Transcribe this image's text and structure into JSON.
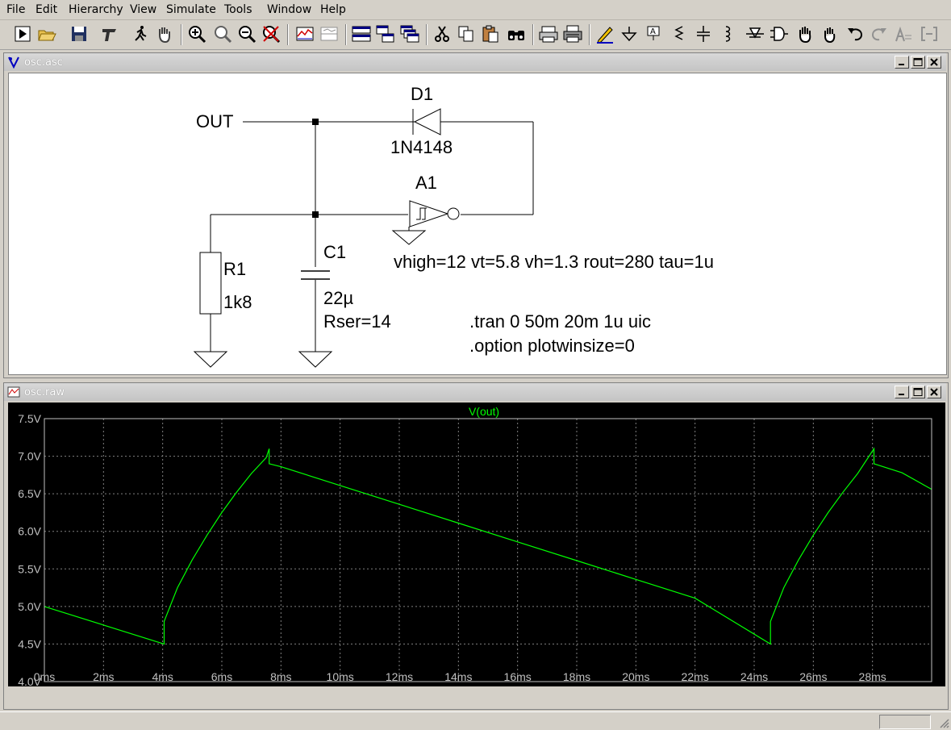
{
  "menu": [
    "File",
    "Edit",
    "Hierarchy",
    "View",
    "Simulate",
    "Tools",
    "Window",
    "Help"
  ],
  "toolbar": {
    "icons": [
      "run-icon",
      "open-icon",
      "save-icon",
      "control-panel-icon",
      "halt-icon",
      "pan-icon",
      "zoom-in-icon",
      "zoom-fit-icon",
      "zoom-out-icon",
      "zoom-cancel-icon",
      "autorange-icon",
      "split-icon",
      "tile-horizontal-icon",
      "tile-vertical-icon",
      "cascade-icon",
      "cut-icon",
      "copy-icon",
      "paste-icon",
      "find-icon",
      "print-preview-icon",
      "print-icon",
      "draw-wire-icon",
      "ground-icon",
      "label-net-icon",
      "resistor-icon",
      "capacitor-icon",
      "inductor-icon",
      "diode-icon",
      "component-icon",
      "move-icon",
      "drag-icon",
      "undo-icon",
      "redo-icon",
      "text-icon",
      "spice-directive-icon"
    ]
  },
  "schematic": {
    "title": "osc.asc",
    "net_out": "OUT",
    "d1": {
      "name": "D1",
      "model": "1N4148"
    },
    "a1": {
      "name": "A1",
      "params": "vhigh=12 vt=5.8 vh=1.3 rout=280 tau=1u"
    },
    "r1": {
      "name": "R1",
      "value": "1k8"
    },
    "c1": {
      "name": "C1",
      "value": "22µ",
      "rser": "Rser=14"
    },
    "directives": [
      ".tran 0 50m 20m 1u uic",
      ".option plotwinsize=0"
    ]
  },
  "plot": {
    "title": "osc.raw",
    "trace_label": "V(out)",
    "trace_color": "#00ff00",
    "background": "#000000",
    "y_ticks": [
      "7.5V",
      "7.0V",
      "6.5V",
      "6.0V",
      "5.5V",
      "5.0V",
      "4.5V",
      "4.0V"
    ],
    "x_ticks": [
      "0ms",
      "2ms",
      "4ms",
      "6ms",
      "8ms",
      "10ms",
      "12ms",
      "14ms",
      "16ms",
      "18ms",
      "20ms",
      "22ms",
      "24ms",
      "26ms",
      "28ms"
    ]
  },
  "chart_data": {
    "type": "line",
    "title": "V(out)",
    "xlim": [
      0,
      30
    ],
    "ylim": [
      4.0,
      7.5
    ],
    "grid": true,
    "series": [
      {
        "name": "V(out)",
        "x": [
          0,
          4.05,
          4.05,
          4.1,
          4.5,
          5.0,
          5.5,
          6.0,
          6.5,
          7.0,
          7.5,
          7.6,
          7.6,
          8,
          10,
          12,
          14,
          16,
          18,
          20,
          22,
          24.55,
          24.55,
          24.6,
          25,
          25.5,
          26,
          26.5,
          27,
          27.5,
          28.05,
          28.05,
          29,
          30
        ],
        "y": [
          5.0,
          4.5,
          4.8,
          4.85,
          5.25,
          5.62,
          5.95,
          6.25,
          6.52,
          6.77,
          6.98,
          7.1,
          6.9,
          6.86,
          6.61,
          6.36,
          6.11,
          5.86,
          5.61,
          5.36,
          5.11,
          4.5,
          4.8,
          4.85,
          5.25,
          5.62,
          5.95,
          6.25,
          6.52,
          6.77,
          7.1,
          6.9,
          6.78,
          6.56
        ]
      }
    ]
  }
}
